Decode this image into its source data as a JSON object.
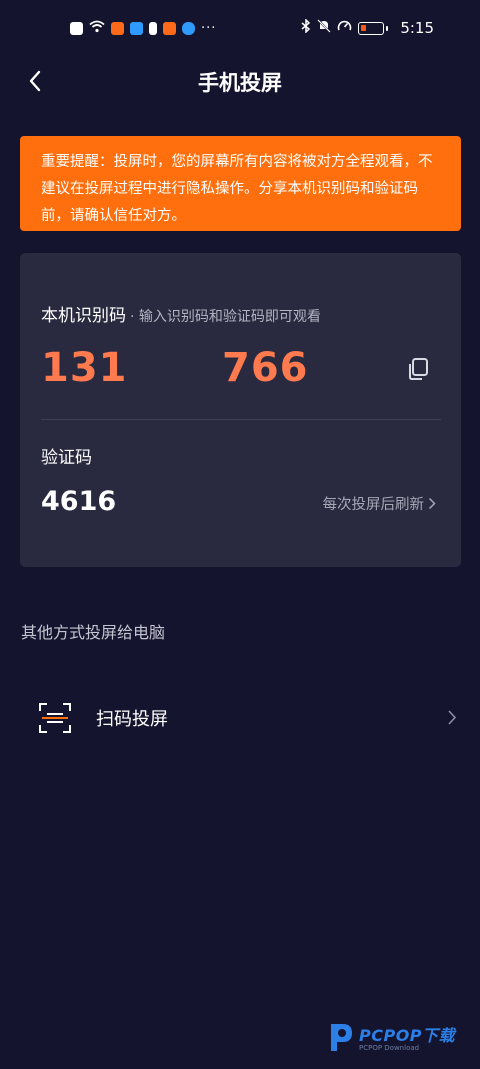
{
  "status_bar": {
    "time": "5:15",
    "more": "···"
  },
  "header": {
    "title": "手机投屏"
  },
  "warning": {
    "text": "重要提醒：投屏时，您的屏幕所有内容将被对方全程观看，不建议在投屏过程中进行隐私操作。分享本机识别码和验证码前，请确认信任对方。"
  },
  "code_card": {
    "label": "本机识别码",
    "hint": "· 输入识别码和验证码即可观看",
    "code_part1": "131",
    "code_part2": "766",
    "verify_label": "验证码",
    "verify_code": "4616",
    "refresh_text": "每次投屏后刷新"
  },
  "other_methods": {
    "title": "其他方式投屏给电脑",
    "scan_label": "扫码投屏"
  },
  "watermark": {
    "main": "PCPOP下载",
    "sub": "PCPOP Download"
  },
  "colors": {
    "background": "#15142e",
    "warning": "#ff6f0d",
    "card": "#292a3f",
    "code_accent": "#ff7a4e"
  },
  "icons": {
    "back": "back-arrow-icon",
    "copy": "copy-icon",
    "refresh_chevron": "chevron-right-icon",
    "scan": "scan-qr-icon",
    "row_chevron": "chevron-right-icon"
  }
}
